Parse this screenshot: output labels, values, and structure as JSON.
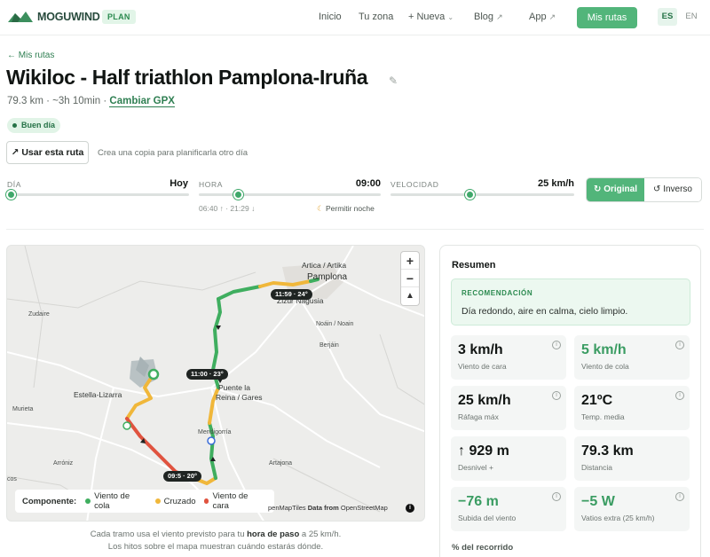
{
  "nav": {
    "brand": "MOGUWIND",
    "plan_badge": "PLAN",
    "links": [
      "Inicio",
      "Tu zona",
      "+ Nueva",
      "Blog",
      "App"
    ],
    "cta": "Mis rutas",
    "lang_active": "ES",
    "lang_inactive": "EN",
    "brand_color": "#52b57a"
  },
  "header": {
    "back": "← Mis rutas",
    "title": "Wikiloc - Half triathlon Pamplona-Iruña",
    "distance": "79.3 km",
    "duration": "~3h 10min",
    "change_gpx": "Cambiar GPX",
    "badge": "Buen día",
    "use_button": "Usar esta ruta",
    "use_help": "Crea una copia para planificarla otro día"
  },
  "controls": {
    "day_label": "DÍA",
    "day_value": "Hoy",
    "day_level": 0.0,
    "hour_label": "HORA",
    "hour_value": "09:00",
    "hour_level": 0.2,
    "hour_note": "06:40 ↑ · 21:29 ↓",
    "night_toggle": "Permitir noche",
    "speed_label": "VELOCIDAD",
    "speed_value": "25 km/h",
    "speed_level": 0.45,
    "original_button": "Original",
    "inverse_button": "Inverso"
  },
  "map": {
    "places": {
      "artica": "Artica / Artika",
      "pamplona": "Pamplona",
      "zizur": "Zizur Nagusia",
      "noain": "Noáin / Noain",
      "berjain": "Berjáin",
      "zudaire": "Zudaire",
      "estella": "Estella-Lizarra",
      "murieta": "Murieta",
      "puente": "Puente la",
      "reina": "Reina / Gares",
      "mendigorria": "Mendigorría",
      "artajona": "Artajona",
      "arroniz": "Arróniz",
      "cos": "cos"
    },
    "time_tags": [
      "11:59 · 24°",
      "11:00 · 23°",
      "09:5 · 20°"
    ],
    "zoom_in": "+",
    "zoom_out": "−",
    "compass": "▲",
    "legend": {
      "label": "Componente:",
      "items": [
        {
          "name": "Viento de cola",
          "color": "#3fae5f"
        },
        {
          "name": "Cruzado",
          "color": "#f0b73a"
        },
        {
          "name": "Viento de cara",
          "color": "#e0533f"
        }
      ]
    },
    "attribution_prefix": "penMapTiles",
    "attribution_data": "Data from",
    "attribution_suffix": "OpenStreetMap",
    "caption_pre": "Cada tramo usa el viento previsto para tu",
    "caption_bold": "hora de paso",
    "caption_post": "a 25 km/h.",
    "caption_line2": "Los hitos sobre el mapa muestran cuándo estarás dónde."
  },
  "summary": {
    "title": "Resumen",
    "rec_title": "RECOMENDACIÓN",
    "rec_text": "Día redondo, aire en calma, cielo limpio.",
    "stats": [
      {
        "value": "3 km/h",
        "label": "Viento de cara"
      },
      {
        "value": "5 km/h",
        "label": "Viento de cola"
      },
      {
        "value": "25 km/h",
        "label": "Ráfaga máx"
      },
      {
        "value": "21ºC",
        "label": "Temp. media"
      },
      {
        "value": "↑ 929 m",
        "label": "Desnivel +"
      },
      {
        "value": "79.3 km",
        "label": "Distancia"
      },
      {
        "value": "−76 m",
        "label": "Subida del viento"
      },
      {
        "value": "−5 W",
        "label": "Vatios extra (25 km/h)"
      }
    ],
    "pct_label": "% del recorrido"
  }
}
